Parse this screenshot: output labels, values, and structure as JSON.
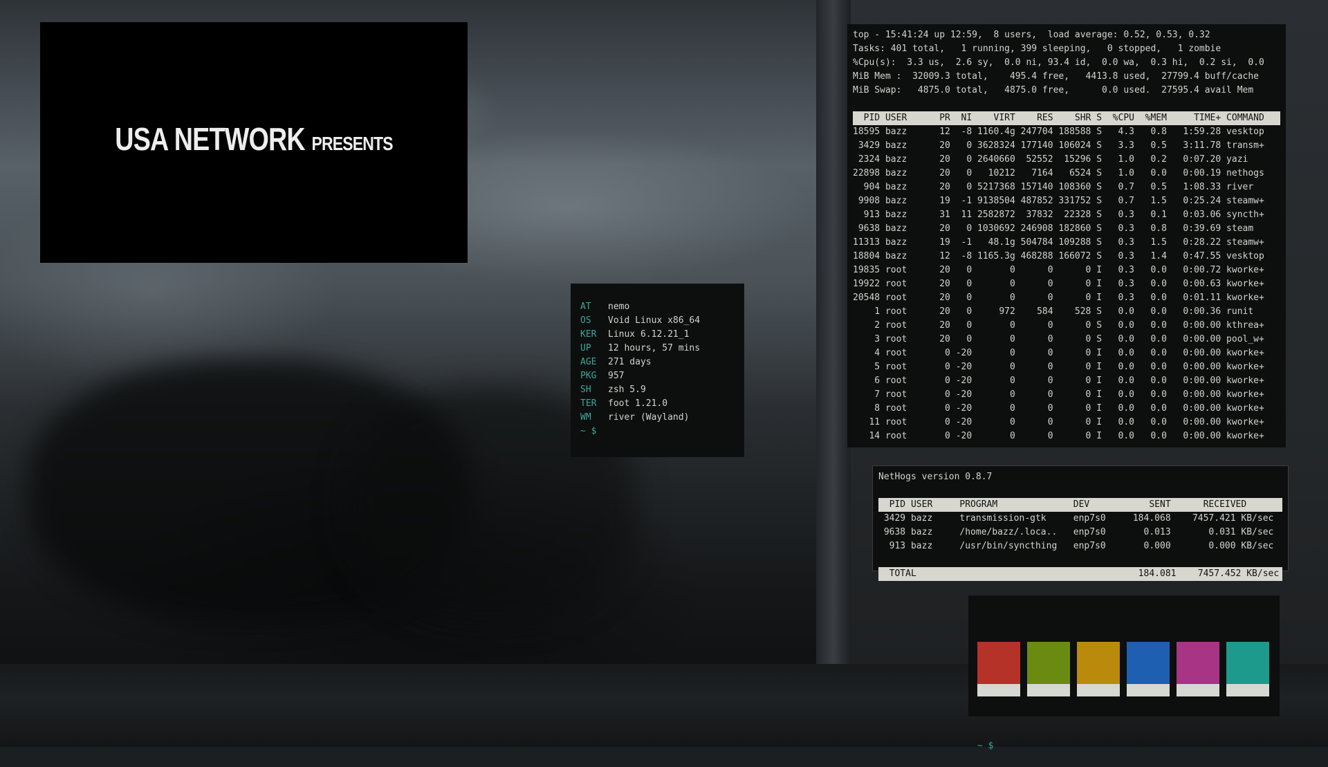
{
  "video": {
    "title": "USA NETWORK",
    "subtitle": "PRESENTS"
  },
  "fetch": {
    "rows": [
      {
        "key": "AT",
        "value": "nemo"
      },
      {
        "key": "OS",
        "value": "Void Linux x86_64"
      },
      {
        "key": "KER",
        "value": "Linux 6.12.21_1"
      },
      {
        "key": "UP",
        "value": "12 hours, 57 mins"
      },
      {
        "key": "AGE",
        "value": "271 days"
      },
      {
        "key": "PKG",
        "value": "957"
      },
      {
        "key": "SH",
        "value": "zsh 5.9"
      },
      {
        "key": "TER",
        "value": "foot 1.21.0"
      },
      {
        "key": "WM",
        "value": "river (Wayland)"
      }
    ],
    "prompt": "~ $"
  },
  "top": {
    "summary": [
      "top - 15:41:24 up 12:59,  8 users,  load average: 0.52, 0.53, 0.32",
      "Tasks: 401 total,   1 running, 399 sleeping,   0 stopped,   1 zombie",
      "%Cpu(s):  3.3 us,  2.6 sy,  0.0 ni, 93.4 id,  0.0 wa,  0.3 hi,  0.2 si,  0.0",
      "MiB Mem :  32009.3 total,    495.4 free,   4413.8 used,  27799.4 buff/cache",
      "MiB Swap:   4875.0 total,   4875.0 free,      0.0 used.  27595.4 avail Mem"
    ],
    "header": "  PID USER      PR  NI    VIRT    RES    SHR S  %CPU  %MEM     TIME+ COMMAND",
    "rows": [
      "18595 bazz      12  -8 1160.4g 247704 188588 S   4.3   0.8   1:59.28 vesktop",
      " 3429 bazz      20   0 3628324 177140 106024 S   3.3   0.5   3:11.78 transm+",
      " 2324 bazz      20   0 2640660  52552  15296 S   1.0   0.2   0:07.20 yazi",
      "22898 bazz      20   0   10212   7164   6524 S   1.0   0.0   0:00.19 nethogs",
      "  904 bazz      20   0 5217368 157140 108360 S   0.7   0.5   1:08.33 river",
      " 9908 bazz      19  -1 9138504 487852 331752 S   0.7   1.5   0:25.24 steamw+",
      "  913 bazz      31  11 2582872  37832  22328 S   0.3   0.1   0:03.06 syncth+",
      " 9638 bazz      20   0 1030692 246908 182860 S   0.3   0.8   0:39.69 steam",
      "11313 bazz      19  -1   48.1g 504784 109288 S   0.3   1.5   0:28.22 steamw+",
      "18804 bazz      12  -8 1165.3g 468288 166072 S   0.3   1.4   0:47.55 vesktop",
      "19835 root      20   0       0      0      0 I   0.3   0.0   0:00.72 kworke+",
      "19922 root      20   0       0      0      0 I   0.3   0.0   0:00.63 kworke+",
      "20548 root      20   0       0      0      0 I   0.3   0.0   0:01.11 kworke+",
      "    1 root      20   0     972    584    528 S   0.0   0.0   0:00.36 runit",
      "    2 root      20   0       0      0      0 S   0.0   0.0   0:00.00 kthrea+",
      "    3 root      20   0       0      0      0 S   0.0   0.0   0:00.00 pool_w+",
      "    4 root       0 -20       0      0      0 I   0.0   0.0   0:00.00 kworke+",
      "    5 root       0 -20       0      0      0 I   0.0   0.0   0:00.00 kworke+",
      "    6 root       0 -20       0      0      0 I   0.0   0.0   0:00.00 kworke+",
      "    7 root       0 -20       0      0      0 I   0.0   0.0   0:00.00 kworke+",
      "    8 root       0 -20       0      0      0 I   0.0   0.0   0:00.00 kworke+",
      "   11 root       0 -20       0      0      0 I   0.0   0.0   0:00.00 kworke+",
      "   14 root       0 -20       0      0      0 I   0.0   0.0   0:00.00 kworke+"
    ]
  },
  "nethogs": {
    "title": "NetHogs version 0.8.7",
    "header": "  PID USER     PROGRAM              DEV           SENT      RECEIVED       ",
    "rows": [
      " 3429 bazz     transmission-gtk     enp7s0     184.068    7457.421 KB/sec",
      " 9638 bazz     /home/bazz/.loca..   enp7s0       0.013       0.031 KB/sec",
      "  913 bazz     /usr/bin/syncthing   enp7s0       0.000       0.000 KB/sec"
    ],
    "total": "  TOTAL                                         184.081    7457.452 KB/sec"
  },
  "palette": {
    "colors": [
      "#b53228",
      "#6b8a12",
      "#b98a0c",
      "#1e5fb2",
      "#a83486",
      "#1e9a8c"
    ],
    "prompt": "~ $"
  }
}
